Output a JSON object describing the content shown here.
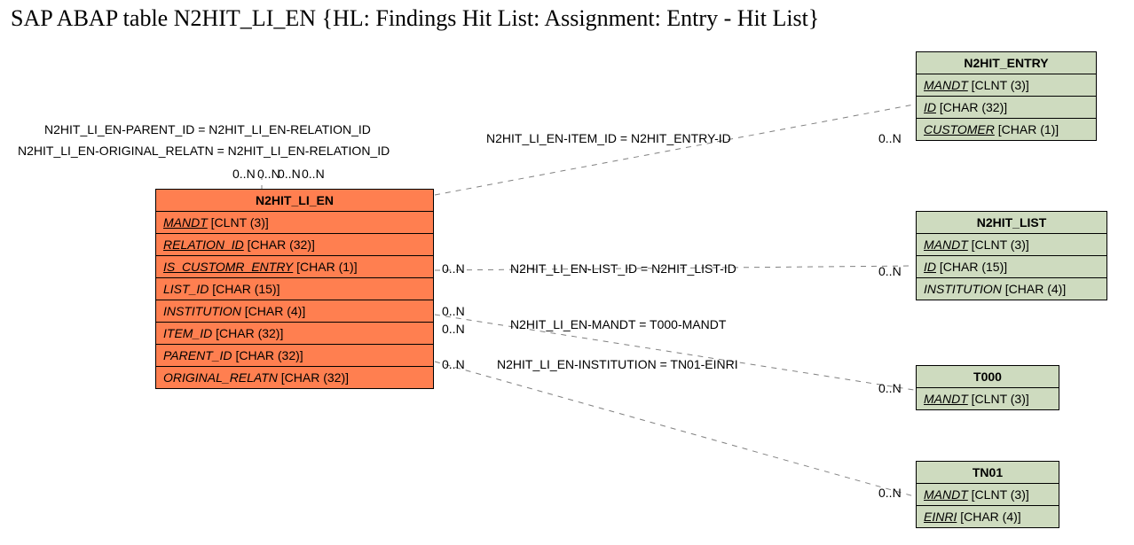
{
  "title": "SAP ABAP table N2HIT_LI_EN {HL: Findings Hit List: Assignment: Entry - Hit List}",
  "entities": {
    "main": {
      "name": "N2HIT_LI_EN",
      "fields": [
        {
          "name": "MANDT",
          "type": "[CLNT (3)]"
        },
        {
          "name": "RELATION_ID",
          "type": "[CHAR (32)]"
        },
        {
          "name": "IS_CUSTOMR_ENTRY",
          "type": "[CHAR (1)]"
        },
        {
          "name": "LIST_ID",
          "type": "[CHAR (15)]"
        },
        {
          "name": "INSTITUTION",
          "type": "[CHAR (4)]"
        },
        {
          "name": "ITEM_ID",
          "type": "[CHAR (32)]"
        },
        {
          "name": "PARENT_ID",
          "type": "[CHAR (32)]"
        },
        {
          "name": "ORIGINAL_RELATN",
          "type": "[CHAR (32)]"
        }
      ]
    },
    "entry": {
      "name": "N2HIT_ENTRY",
      "fields": [
        {
          "name": "MANDT",
          "type": "[CLNT (3)]"
        },
        {
          "name": "ID",
          "type": "[CHAR (32)]"
        },
        {
          "name": "CUSTOMER",
          "type": "[CHAR (1)]"
        }
      ]
    },
    "list": {
      "name": "N2HIT_LIST",
      "fields": [
        {
          "name": "MANDT",
          "type": "[CLNT (3)]"
        },
        {
          "name": "ID",
          "type": "[CHAR (15)]"
        },
        {
          "name": "INSTITUTION",
          "type": "[CHAR (4)]"
        }
      ]
    },
    "t000": {
      "name": "T000",
      "fields": [
        {
          "name": "MANDT",
          "type": "[CLNT (3)]"
        }
      ]
    },
    "tn01": {
      "name": "TN01",
      "fields": [
        {
          "name": "MANDT",
          "type": "[CLNT (3)]"
        },
        {
          "name": "EINRI",
          "type": "[CHAR (4)]"
        }
      ]
    }
  },
  "relations": {
    "r1a": "N2HIT_LI_EN-PARENT_ID = N2HIT_LI_EN-RELATION_ID",
    "r1b": "N2HIT_LI_EN-ORIGINAL_RELATN = N2HIT_LI_EN-RELATION_ID",
    "r2": "N2HIT_LI_EN-ITEM_ID = N2HIT_ENTRY-ID",
    "r3": "N2HIT_LI_EN-LIST_ID = N2HIT_LIST-ID",
    "r4": "N2HIT_LI_EN-MANDT = T000-MANDT",
    "r5": "N2HIT_LI_EN-INSTITUTION = TN01-EINRI"
  },
  "card": {
    "c1": "0..N",
    "c2": "0..N",
    "c3": "0..N",
    "c4": "0..N",
    "c5": "0..N",
    "c6": "0..N",
    "c7": "0..N",
    "c8": "0..N",
    "c9": "0..N",
    "c10": "0..N",
    "c11": "0..N"
  }
}
